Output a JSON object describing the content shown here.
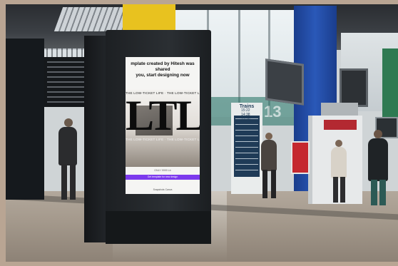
{
  "scene": {
    "setting": "train station concourse",
    "colors": {
      "board_frame": "#1f2226",
      "blue_column": "#2a58b8",
      "yellow_column": "#e8c21f",
      "cta_purple": "#7c3aed",
      "floor": "#a59a8d"
    }
  },
  "billboard": {
    "message": "mplate created by Hitesh was shared\nyou, start designing now",
    "ticker_top": "THE LOW-TICKET LIFE · THE LOW-TICKET LIFE",
    "logo_text": "LTL",
    "ticker_bottom": "THE LOW-TICKET LIFE · THE LOW-TICKET LIFE",
    "subtext": "ONLY 9999 Ltr",
    "cta_label": "Get template for new design",
    "footer": "Snapshots Canva"
  },
  "background": {
    "platform_sign_text": "13",
    "departures_title": "Trains",
    "departures_times": [
      "15:22",
      "14:38",
      "15:50"
    ]
  }
}
